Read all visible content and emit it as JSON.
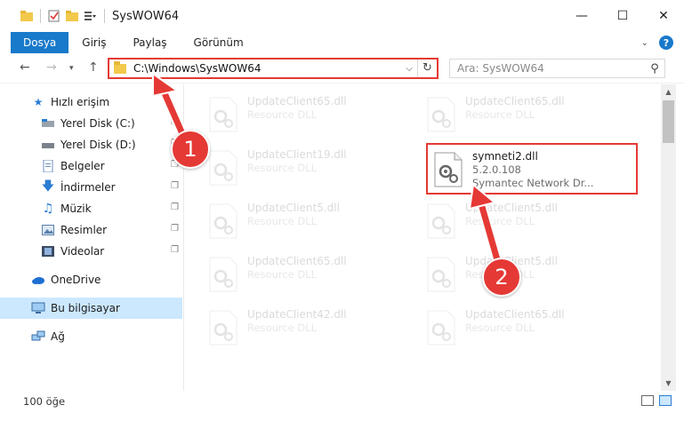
{
  "window": {
    "title": "SysWOW64",
    "minimize": "—",
    "maximize": "☐",
    "close": "✕"
  },
  "ribbon": {
    "tabs": [
      {
        "label": "Dosya"
      },
      {
        "label": "Giriş"
      },
      {
        "label": "Paylaş"
      },
      {
        "label": "Görünüm"
      }
    ],
    "help": "?"
  },
  "address": {
    "path": "C:\\Windows\\SysWOW64",
    "search_placeholder": "Ara: SysWOW64"
  },
  "sidebar": {
    "items": [
      {
        "label": "Hızlı erişim"
      },
      {
        "label": "Yerel Disk (C:)"
      },
      {
        "label": "Yerel Disk (D:)"
      },
      {
        "label": "Belgeler"
      },
      {
        "label": "İndirmeler"
      },
      {
        "label": "Müzik"
      },
      {
        "label": "Resimler"
      },
      {
        "label": "Videolar"
      },
      {
        "label": "OneDrive"
      },
      {
        "label": "Bu bilgisayar"
      },
      {
        "label": "Ağ"
      }
    ]
  },
  "files": [
    {
      "name": "UpdateClient65.dll",
      "desc": "Resource DLL"
    },
    {
      "name": "UpdateClient65.dll",
      "desc": "Resource DLL"
    },
    {
      "name": "UpdateClient19.dll",
      "desc": "Resource DLL"
    },
    {
      "name": "symneti2.dll",
      "version": "5.2.0.108",
      "desc": "Symantec Network Dr..."
    },
    {
      "name": "UpdateClient5.dll",
      "desc": "Resource DLL"
    },
    {
      "name": "UpdateClient5.dll",
      "desc": "Resource DLL"
    },
    {
      "name": "UpdateClient65.dll",
      "desc": "Resource DLL"
    },
    {
      "name": "UpdateClient5.dll",
      "desc": "Resource DLL"
    },
    {
      "name": "UpdateClient42.dll",
      "desc": "Resource DLL"
    },
    {
      "name": "UpdateClient65.dll",
      "desc": "Resource DLL"
    }
  ],
  "status": {
    "count": "100 öğe"
  },
  "annotations": {
    "badge1": "1",
    "badge2": "2",
    "color": "#e53935"
  },
  "colors": {
    "accent": "#1979ca",
    "selection": "#cce8ff",
    "highlight": "#e53935"
  }
}
